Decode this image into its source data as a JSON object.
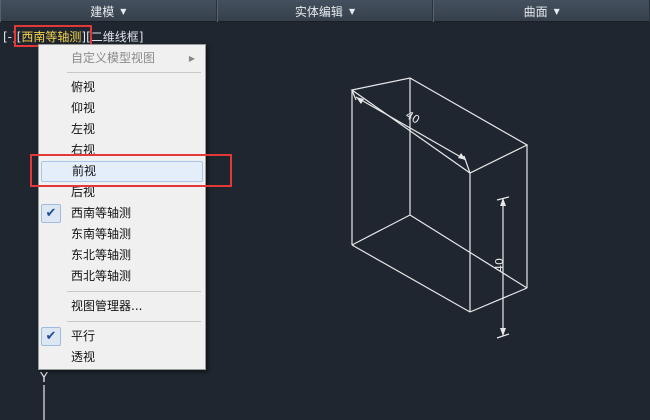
{
  "topbar": {
    "tabs": [
      {
        "label": "建模"
      },
      {
        "label": "实体编辑"
      },
      {
        "label": "曲面"
      }
    ]
  },
  "viewport_label": {
    "prefix": "[-]",
    "view": "西南等轴测",
    "style": "二维线框"
  },
  "context_menu": {
    "items": [
      {
        "label": "自定义模型视图",
        "disabled": true,
        "submenu": true
      },
      {
        "label": "俯视"
      },
      {
        "label": "仰视"
      },
      {
        "label": "左视"
      },
      {
        "label": "右视"
      },
      {
        "label": "前视",
        "highlighted": true
      },
      {
        "label": "后视"
      },
      {
        "label": "西南等轴测",
        "checked": true
      },
      {
        "label": "东南等轴测"
      },
      {
        "label": "东北等轴测"
      },
      {
        "label": "西北等轴测"
      },
      {
        "label": "视图管理器..."
      },
      {
        "label": "平行",
        "checked": true
      },
      {
        "label": "透视"
      }
    ]
  },
  "drawing": {
    "dimension_top": "40",
    "dimension_side": "40",
    "ucs_axis": "Y"
  },
  "colors": {
    "background": "#1f2630",
    "annotation": "#e23838",
    "view_name": "#f2d24a",
    "check": "#1e4c9a"
  }
}
